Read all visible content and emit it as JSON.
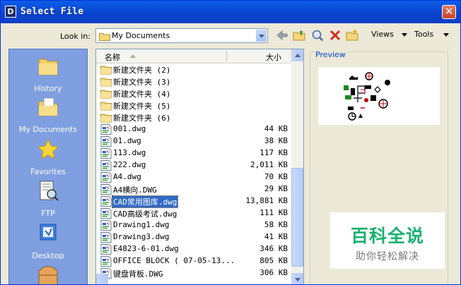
{
  "window": {
    "app_icon_letter": "D",
    "title": "Select File",
    "close_glyph": "✕"
  },
  "toolbar": {
    "look_in_label": "Look in:",
    "look_in_value": "My Documents",
    "icons": [
      "back-arrow-icon",
      "up-folder-icon",
      "search-web-icon",
      "delete-icon",
      "new-folder-icon"
    ],
    "views_label": "Views",
    "tools_label": "Tools"
  },
  "places": [
    {
      "label": "History",
      "icon": "history-folder-icon"
    },
    {
      "label": "My Documents",
      "icon": "my-documents-icon"
    },
    {
      "label": "Favorites",
      "icon": "favorites-star-icon"
    },
    {
      "label": "FTP",
      "icon": "ftp-icon"
    },
    {
      "label": "Desktop",
      "icon": "desktop-icon"
    }
  ],
  "file_list": {
    "columns": {
      "name": "名称",
      "size": "大小"
    },
    "selected_index": 11,
    "rows": [
      {
        "name": "新建文件夹 (2)",
        "size": "",
        "kind": "folder"
      },
      {
        "name": "新建文件夹 (3)",
        "size": "",
        "kind": "folder"
      },
      {
        "name": "新建文件夹 (4)",
        "size": "",
        "kind": "folder"
      },
      {
        "name": "新建文件夹 (5)",
        "size": "",
        "kind": "folder"
      },
      {
        "name": "新建文件夹 (6)",
        "size": "",
        "kind": "folder"
      },
      {
        "name": "001.dwg",
        "size": "44 KB",
        "kind": "dwg"
      },
      {
        "name": "01.dwg",
        "size": "38 KB",
        "kind": "dwg"
      },
      {
        "name": "113.dwg",
        "size": "117 KB",
        "kind": "dwg"
      },
      {
        "name": "222.dwg",
        "size": "2,011 KB",
        "kind": "dwg"
      },
      {
        "name": "A4.dwg",
        "size": "70 KB",
        "kind": "dwg"
      },
      {
        "name": "A4横向.DWG",
        "size": "29 KB",
        "kind": "dwg"
      },
      {
        "name": "CAD常用图库.dwg",
        "size": "13,881 KB",
        "kind": "dwg"
      },
      {
        "name": "CAD高级考试.dwg",
        "size": "111 KB",
        "kind": "dwg"
      },
      {
        "name": "Drawing1.dwg",
        "size": "58 KB",
        "kind": "dwg"
      },
      {
        "name": "Drawing3.dwg",
        "size": "41 KB",
        "kind": "dwg"
      },
      {
        "name": "E4823-6-01.dwg",
        "size": "346 KB",
        "kind": "dwg"
      },
      {
        "name": "OFFICE BLOCK ( 07-05-13...",
        "size": "805 KB",
        "kind": "dwg"
      },
      {
        "name": "键盘背板.DWG",
        "size": "306 KB",
        "kind": "dwg"
      }
    ]
  },
  "preview": {
    "label": "Preview"
  },
  "watermark": {
    "title": "百科全说",
    "subtitle": "助你轻松解决"
  },
  "colors": {
    "title_bar": "#0a4fd6",
    "places_bar": "#7f9fe0",
    "selection": "#316ac5",
    "watermark_green": "#1bb170"
  }
}
